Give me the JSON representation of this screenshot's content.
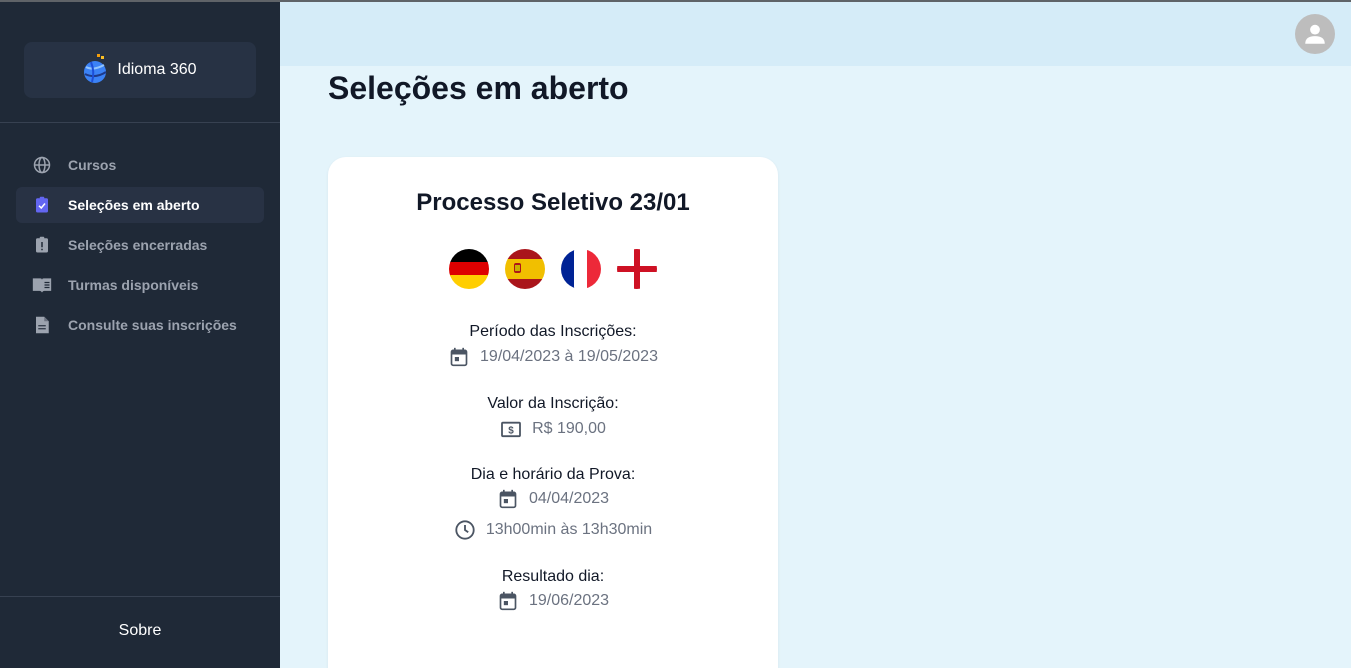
{
  "app": {
    "brand_name": "Idioma 360"
  },
  "sidebar": {
    "items": [
      {
        "label": "Cursos",
        "icon": "globe-icon",
        "active": false
      },
      {
        "label": "Seleções em aberto",
        "icon": "clipboard-check-icon",
        "active": true
      },
      {
        "label": "Seleções encerradas",
        "icon": "clipboard-alert-icon",
        "active": false
      },
      {
        "label": "Turmas disponíveis",
        "icon": "book-open-icon",
        "active": false
      },
      {
        "label": "Consulte suas inscrições",
        "icon": "document-icon",
        "active": false
      }
    ],
    "footer_label": "Sobre"
  },
  "header": {
    "avatar_icon": "user-avatar-icon"
  },
  "main": {
    "title": "Seleções em aberto",
    "card": {
      "title": "Processo Seletivo 23/01",
      "flags": [
        "germany-flag",
        "spain-flag",
        "france-flag",
        "england-flag"
      ],
      "registration_period_label": "Período das Inscrições:",
      "registration_period_value": "19/04/2023 à 19/05/2023",
      "fee_label": "Valor da Inscrição:",
      "fee_value": "R$ 190,00",
      "exam_label": "Dia e horário da Prova:",
      "exam_date": "04/04/2023",
      "exam_time": "13h00min às 13h30min",
      "result_label": "Resultado dia:",
      "result_date": "19/06/2023"
    }
  },
  "colors": {
    "sidebar_bg": "#1f2937",
    "main_bg": "#e4f4fb",
    "header_bg": "#d5ecf8",
    "accent": "#6366f1"
  }
}
